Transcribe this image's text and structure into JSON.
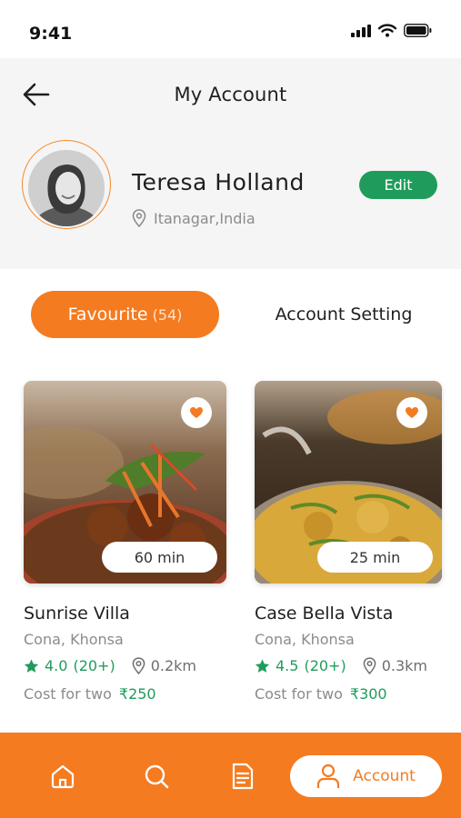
{
  "status_bar": {
    "time": "9:41"
  },
  "header": {
    "title": "My Account"
  },
  "profile": {
    "name": "Teresa Holland",
    "location": "Itanagar,India",
    "edit_label": "Edit"
  },
  "tabs": {
    "favourite_label": "Favourite",
    "favourite_count": "(54)",
    "account_setting_label": "Account Setting"
  },
  "restaurants": [
    {
      "name": "Sunrise Villa",
      "address": "Cona, Khonsa",
      "rating": "4.0",
      "reviews": "(20+)",
      "distance": "0.2km",
      "cost_label": "Cost for two",
      "cost": "₹250",
      "time": "60 min"
    },
    {
      "name": "Case Bella Vista",
      "address": "Cona, Khonsa",
      "rating": "4.5",
      "reviews": "(20+)",
      "distance": "0.3km",
      "cost_label": "Cost for two",
      "cost": "₹300",
      "time": "25 min"
    }
  ],
  "bottom_nav": {
    "active_label": "Account"
  },
  "colors": {
    "accent": "#f47b20",
    "green": "#1f9c5c",
    "header_bg": "#f5f5f5"
  }
}
